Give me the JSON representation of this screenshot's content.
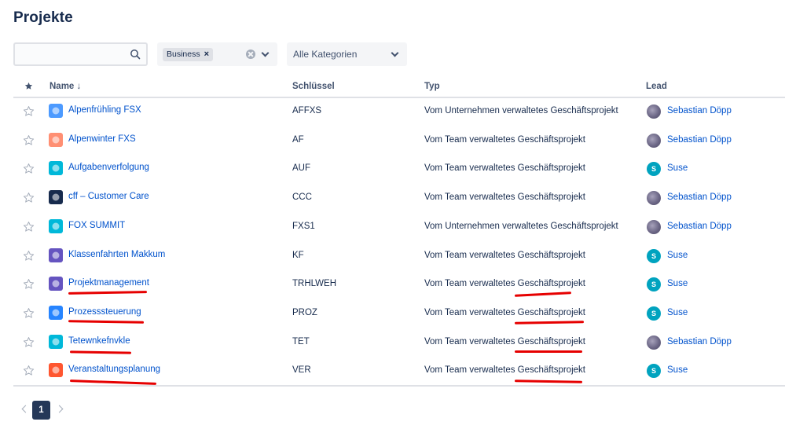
{
  "page": {
    "title": "Projekte"
  },
  "filters": {
    "search": {
      "value": "",
      "placeholder": ""
    },
    "type_chip": "Business",
    "chip_remove": "×",
    "category": "Alle Kategorien"
  },
  "table": {
    "headers": {
      "name": "Name ↓",
      "key": "Schlüssel",
      "type": "Typ",
      "lead": "Lead"
    },
    "rows": [
      {
        "name": "Alpenfrühling FSX",
        "key": "AFFXS",
        "type": "Vom Unternehmen verwaltetes Geschäftsprojekt",
        "lead": "Sebastian Döpp",
        "icon": "mountain-icon",
        "icon_color": "#4c9aff"
      },
      {
        "name": "Alpenwinter FXS",
        "key": "AF",
        "type": "Vom Team verwaltetes Geschäftsprojekt",
        "lead": "Sebastian Döpp",
        "icon": "person-icon",
        "icon_color": "#ff8f73"
      },
      {
        "name": "Aufgabenverfolgung",
        "key": "AUF",
        "type": "Vom Team verwaltetes Geschäftsprojekt",
        "lead": "Suse",
        "icon": "target-icon",
        "icon_color": "#00b8d9"
      },
      {
        "name": "cff – Customer Care",
        "key": "CCC",
        "type": "Vom Team verwaltetes Geschäftsprojekt",
        "lead": "Sebastian Döpp",
        "icon": "rocket-icon",
        "icon_color": "#172b4d"
      },
      {
        "name": "FOX SUMMIT",
        "key": "FXS1",
        "type": "Vom Unternehmen verwaltetes Geschäftsprojekt",
        "lead": "Sebastian Döpp",
        "icon": "truck-icon",
        "icon_color": "#00b8d9"
      },
      {
        "name": "Klassenfahrten Makkum",
        "key": "KF",
        "type": "Vom Team verwaltetes Geschäftsprojekt",
        "lead": "Suse",
        "icon": "bird-icon",
        "icon_color": "#6554c0"
      },
      {
        "name": "Projektmanagement",
        "key": "TRHLWEH",
        "type": "Vom Team verwaltetes Geschäftsprojekt",
        "lead": "Suse",
        "icon": "cloud-icon",
        "icon_color": "#6554c0"
      },
      {
        "name": "Prozesssteuerung",
        "key": "PROZ",
        "type": "Vom Team verwaltetes Geschäftsprojekt",
        "lead": "Suse",
        "icon": "gear-icon",
        "icon_color": "#2684ff"
      },
      {
        "name": "Tetewnkefnvkle",
        "key": "TET",
        "type": "Vom Team verwaltetes Geschäftsprojekt",
        "lead": "Sebastian Döpp",
        "icon": "notepad-icon",
        "icon_color": "#00b8d9"
      },
      {
        "name": "Veranstaltungsplanung",
        "key": "VER",
        "type": "Vom Team verwaltetes Geschäftsprojekt",
        "lead": "Suse",
        "icon": "briefcase-icon",
        "icon_color": "#ff5630"
      }
    ]
  },
  "avatar_initial": "S",
  "pagination": {
    "current": "1"
  },
  "colors": {
    "link": "#0052cc",
    "annotation": "#e60000"
  }
}
